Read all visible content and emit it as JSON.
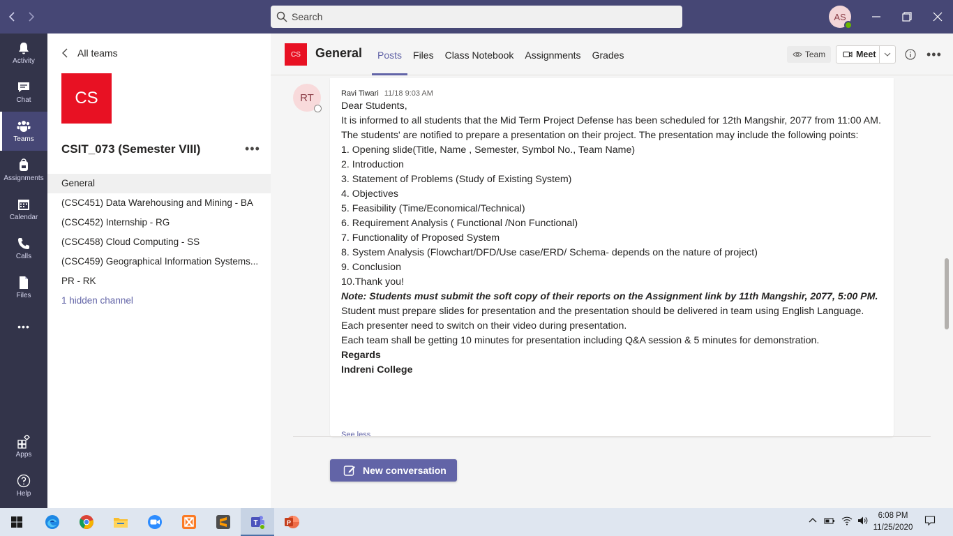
{
  "titlebar": {
    "search_placeholder": "Search",
    "user_initials": "AS"
  },
  "rail": {
    "items": [
      {
        "label": "Activity",
        "icon": "bell-icon"
      },
      {
        "label": "Chat",
        "icon": "chat-icon"
      },
      {
        "label": "Teams",
        "icon": "teams-icon",
        "active": true
      },
      {
        "label": "Assignments",
        "icon": "backpack-icon"
      },
      {
        "label": "Calendar",
        "icon": "calendar-icon"
      },
      {
        "label": "Calls",
        "icon": "phone-icon"
      },
      {
        "label": "Files",
        "icon": "file-icon"
      }
    ],
    "more": "•••",
    "bottom": [
      {
        "label": "Apps",
        "icon": "apps-icon"
      },
      {
        "label": "Help",
        "icon": "help-icon"
      }
    ]
  },
  "teams_panel": {
    "back_label": "All teams",
    "team_initials": "CS",
    "team_name": "CSIT_073 (Semester VIII)",
    "more": "•••",
    "channels": [
      "General",
      "(CSC451) Data Warehousing and Mining - BA",
      "(CSC452) Internship - RG",
      "(CSC458) Cloud Computing - SS",
      "(CSC459) Geographical Information Systems...",
      "PR - RK"
    ],
    "hidden_channels": "1 hidden channel"
  },
  "header": {
    "channel_icon_text": "CS",
    "channel_title": "General",
    "tabs": [
      "Posts",
      "Files",
      "Class Notebook",
      "Assignments",
      "Grades"
    ],
    "team_button": "Team",
    "meet_button": "Meet",
    "more": "•••"
  },
  "post": {
    "author_initials": "RT",
    "author": "Ravi Tiwari",
    "timestamp": "11/18 9:03 AM",
    "greeting": "Dear Students,",
    "intro": "It is informed to all students that the Mid Term Project Defense has been scheduled for 12th Mangshir, 2077 from 11:00 AM. The students' are notified to prepare a presentation on their project. The presentation may include the following points:",
    "points": [
      "1. Opening slide(Title, Name , Semester, Symbol No., Team Name)",
      "2. Introduction",
      "3. Statement of Problems (Study of Existing System)",
      "4. Objectives",
      "5. Feasibility (Time/Economical/Technical)",
      "6. Requirement Analysis ( Functional /Non Functional)",
      "7. Functionality of Proposed System",
      "8. System Analysis (Flowchart/DFD/Use case/ERD/ Schema- depends on the nature of project)",
      "9. Conclusion",
      "10.Thank you!"
    ],
    "note": "Note: Students must submit the soft copy of their reports on the Assignment link by 11th Mangshir, 2077, 5:00 PM.",
    "paragraphs": [
      "Student must prepare slides for presentation and the presentation should be delivered in team using English Language.",
      "Each presenter need to switch on their video during presentation.",
      "Each team shall be getting 10 minutes for presentation including Q&A session & 5 minutes for demonstration."
    ],
    "regards": "Regards",
    "signature": "Indreni College",
    "see_less": "See less"
  },
  "new_conversation": "New conversation",
  "taskbar": {
    "time": "6:08 PM",
    "date": "11/25/2020",
    "apps": [
      "windows-start-icon",
      "edge-icon",
      "chrome-icon",
      "file-explorer-icon",
      "zoom-icon",
      "xampp-icon",
      "sublime-text-icon",
      "teams-icon",
      "powerpoint-icon"
    ]
  },
  "colors": {
    "titlebar": "#464775",
    "rail": "#33344a",
    "accent": "#6264a7",
    "team_tile": "#e81123"
  }
}
